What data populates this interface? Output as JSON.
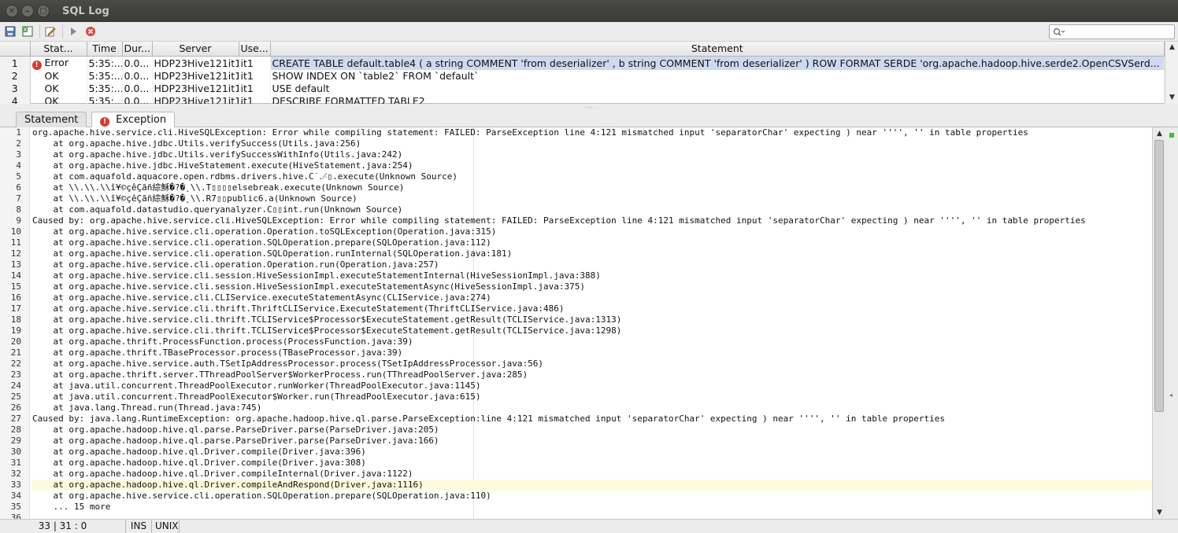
{
  "window": {
    "title": "SQL Log"
  },
  "toolbar": {
    "search_placeholder": ""
  },
  "log": {
    "columns": [
      "",
      "Stat...",
      "Time",
      "Dur...",
      "Server",
      "Use...",
      "Statement"
    ],
    "rows": [
      {
        "num": "1",
        "status": "Error",
        "time": "5:35:...",
        "dur": "0.0...",
        "server": "HDP23Hive121it1",
        "user": "it1",
        "statement": "CREATE TABLE default.table4  (    a string COMMENT 'from deserializer' ,    b string COMMENT 'from deserializer' ) ROW FORMAT SERDE 'org.apache.hadoop.hive.serde2.OpenCSVSerd..."
      },
      {
        "num": "2",
        "status": "OK",
        "time": "5:35:...",
        "dur": "0.0...",
        "server": "HDP23Hive121it1",
        "user": "it1",
        "statement": "SHOW INDEX ON `table2` FROM `default`"
      },
      {
        "num": "3",
        "status": "OK",
        "time": "5:35:...",
        "dur": "0.0...",
        "server": "HDP23Hive121it1",
        "user": "it1",
        "statement": "USE default"
      },
      {
        "num": "4",
        "status": "OK",
        "time": "5:35:...",
        "dur": "0.0...",
        "server": "HDP23Hive121it1",
        "user": "it1",
        "statement": "DESCRIBE FORMATTED TABLE2"
      }
    ]
  },
  "tabs": {
    "statement": "Statement",
    "exception": "Exception"
  },
  "exception_lines": [
    "org.apache.hive.service.cli.HiveSQLException: Error while compiling statement: FAILED: ParseException line 4:121 mismatched input 'separatorChar' expecting ) near '''', '' in table properties",
    "    at org.apache.hive.jdbc.Utils.verifySuccess(Utils.java:256)",
    "    at org.apache.hive.jdbc.Utils.verifySuccessWithInfo(Utils.java:242)",
    "    at org.apache.hive.jdbc.HiveStatement.execute(HiveStatement.java:254)",
    "    at com.aquafold.aquacore.open.rdbms.drivers.hive.C˙․⳺▯.execute(Unknown Source)",
    "    at \\\\.\\\\.\\\\î¥©çêÇãñ綜穌�?�˛\\\\.T▯▯▯▯elsebreak.execute(Unknown Source)",
    "    at \\\\.\\\\.\\\\î¥©çêÇãñ綜穌�?�˛\\\\.R7▯▯public6.a(Unknown Source)",
    "    at com.aquafold.datastudio.queryanalyzer.C▯▯int.run(Unknown Source)",
    "Caused by: org.apache.hive.service.cli.HiveSQLException: Error while compiling statement: FAILED: ParseException line 4:121 mismatched input 'separatorChar' expecting ) near '''', '' in table properties",
    "    at org.apache.hive.service.cli.operation.Operation.toSQLException(Operation.java:315)",
    "    at org.apache.hive.service.cli.operation.SQLOperation.prepare(SQLOperation.java:112)",
    "    at org.apache.hive.service.cli.operation.SQLOperation.runInternal(SQLOperation.java:181)",
    "    at org.apache.hive.service.cli.operation.Operation.run(Operation.java:257)",
    "    at org.apache.hive.service.cli.session.HiveSessionImpl.executeStatementInternal(HiveSessionImpl.java:388)",
    "    at org.apache.hive.service.cli.session.HiveSessionImpl.executeStatementAsync(HiveSessionImpl.java:375)",
    "    at org.apache.hive.service.cli.CLIService.executeStatementAsync(CLIService.java:274)",
    "    at org.apache.hive.service.cli.thrift.ThriftCLIService.ExecuteStatement(ThriftCLIService.java:486)",
    "    at org.apache.hive.service.cli.thrift.TCLIService$Processor$ExecuteStatement.getResult(TCLIService.java:1313)",
    "    at org.apache.hive.service.cli.thrift.TCLIService$Processor$ExecuteStatement.getResult(TCLIService.java:1298)",
    "    at org.apache.thrift.ProcessFunction.process(ProcessFunction.java:39)",
    "    at org.apache.thrift.TBaseProcessor.process(TBaseProcessor.java:39)",
    "    at org.apache.hive.service.auth.TSetIpAddressProcessor.process(TSetIpAddressProcessor.java:56)",
    "    at org.apache.thrift.server.TThreadPoolServer$WorkerProcess.run(TThreadPoolServer.java:285)",
    "    at java.util.concurrent.ThreadPoolExecutor.runWorker(ThreadPoolExecutor.java:1145)",
    "    at java.util.concurrent.ThreadPoolExecutor$Worker.run(ThreadPoolExecutor.java:615)",
    "    at java.lang.Thread.run(Thread.java:745)",
    "Caused by: java.lang.RuntimeException: org.apache.hadoop.hive.ql.parse.ParseException:line 4:121 mismatched input 'separatorChar' expecting ) near '''', '' in table properties",
    "    at org.apache.hadoop.hive.ql.parse.ParseDriver.parse(ParseDriver.java:205)",
    "    at org.apache.hadoop.hive.ql.parse.ParseDriver.parse(ParseDriver.java:166)",
    "    at org.apache.hadoop.hive.ql.Driver.compile(Driver.java:396)",
    "    at org.apache.hadoop.hive.ql.Driver.compile(Driver.java:308)",
    "    at org.apache.hadoop.hive.ql.Driver.compileInternal(Driver.java:1122)",
    "    at org.apache.hadoop.hive.ql.Driver.compileAndRespond(Driver.java:1116)",
    "    at org.apache.hive.service.cli.operation.SQLOperation.prepare(SQLOperation.java:110)",
    "    ... 15 more",
    ""
  ],
  "highlight_line": 33,
  "status": {
    "position": "33 | 31 : 0",
    "mode": "INS",
    "eol": "UNIX"
  },
  "colors": {
    "error": "#d93a2b",
    "selection": "#cfdaf0",
    "current_line": "#fcfbdd"
  }
}
